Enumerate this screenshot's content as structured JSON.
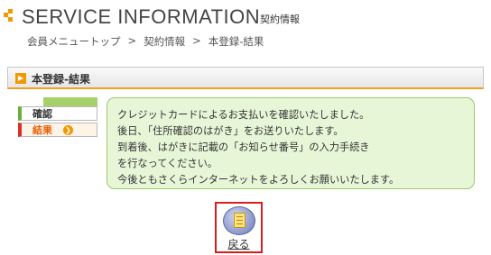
{
  "header": {
    "title": "SERVICE INFORMATION",
    "subtitle": "契約情報"
  },
  "breadcrumb": {
    "items": [
      "会員メニュートップ",
      "契約情報",
      "本登録-結果"
    ],
    "separator": ">"
  },
  "section": {
    "title": "本登録-結果",
    "icon": "play-square-icon"
  },
  "steps": [
    {
      "label": "確認",
      "active": false
    },
    {
      "label": "結果",
      "active": true,
      "icon": "arrow-circle-icon"
    }
  ],
  "message": {
    "lines": [
      "クレジットカードによるお支払いを確認いたしました。",
      "後日、「住所確認のはがき」をお送りいたします。",
      "到着後、はがきに記載の「お知らせ番号」の入力手続き",
      "を行なってください。",
      "今後ともさくらインターネットをよろしくお願いいたします。"
    ]
  },
  "back": {
    "label": "戻る",
    "icon": "document-icon"
  },
  "colors": {
    "accent": "#f39800",
    "message_bg": "#e8f6d8",
    "message_border": "#9cc86a",
    "active_step": "#e8600a",
    "highlight": "#d42020"
  }
}
